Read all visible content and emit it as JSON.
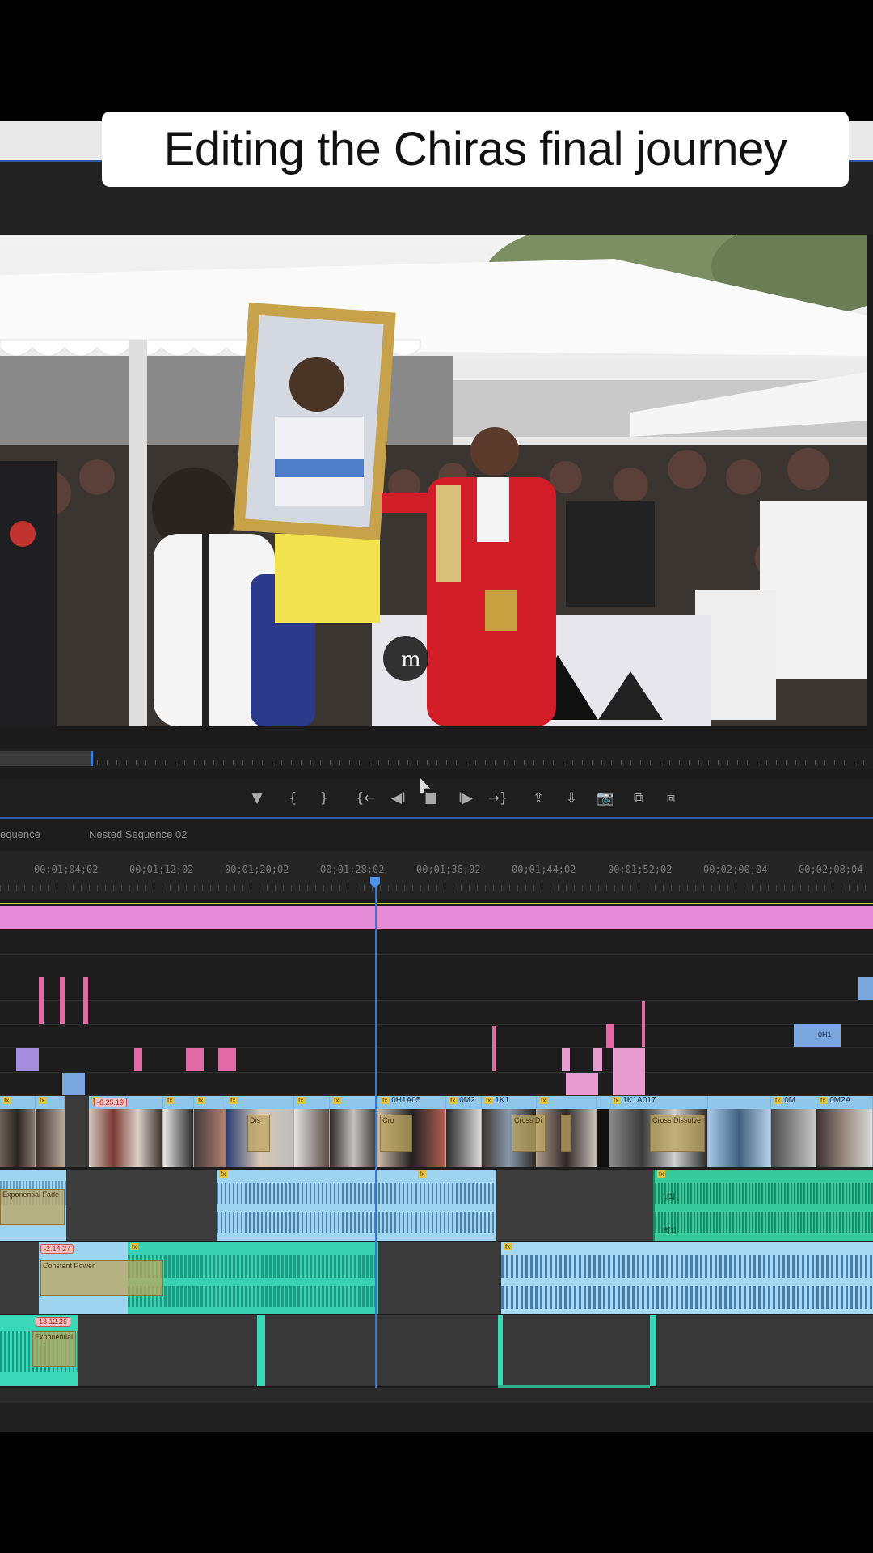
{
  "caption": {
    "text": "Editing the Chiras final journey"
  },
  "program_monitor": {
    "watermark": "m"
  },
  "transport": {
    "marker_icon": "marker-icon",
    "mark_in_label": "{",
    "mark_out_label": "}",
    "go_to_in_label": "{←",
    "step_back_label": "◀I",
    "stop_label": "■",
    "step_forward_label": "I▶",
    "go_to_out_label": "→}",
    "lift_label": "⇪",
    "extract_label": "⇩",
    "export_frame_label": "📷",
    "compare_label": "⧉",
    "settings_label": "⧈"
  },
  "sequence_tabs": [
    "equence",
    "Nested Sequence 02"
  ],
  "ruler": {
    "timecodes": [
      "00;01;04;02",
      "00;01;12;02",
      "00;01;20;02",
      "00;01;28;02",
      "00;01;36;02",
      "00;01;44;02",
      "00;01;52;02",
      "00;02;00;04",
      "00;02;08;04"
    ]
  },
  "timeline": {
    "clip_labels": [
      "0H1A05",
      "0M2",
      "1K1",
      "1K1A017",
      "0M",
      "0M2A",
      "0H1"
    ],
    "tags": [
      "-6.25.19",
      "-2.14.27",
      "13.12.26"
    ],
    "effect_labels": [
      "Constant Power",
      "Cross Dissolve",
      "Exponential",
      "Exponential Fade",
      "Cross Di",
      "Dis",
      "Cro"
    ],
    "channel_labels": [
      "L[1]",
      "R[1]"
    ]
  },
  "colors": {
    "pink_band": "#e58ad5",
    "audio_blue": "#9ed4f0",
    "audio_green": "#38c99a",
    "playhead": "#3c78c8"
  }
}
